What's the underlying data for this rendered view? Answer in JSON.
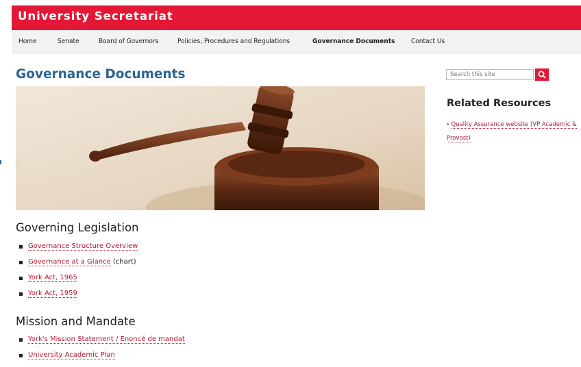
{
  "header": {
    "site_title": "University Secretariat"
  },
  "nav": {
    "items": [
      {
        "label": "Home"
      },
      {
        "label": "Senate"
      },
      {
        "label": "Board of Governors"
      },
      {
        "label": "Policies, Procedures and Regulations"
      },
      {
        "label": "Governance Documents"
      },
      {
        "label": "Contact Us"
      }
    ],
    "active": "Governance Documents"
  },
  "main": {
    "page_title": "Governance Documents",
    "hero_image": "gavel-on-sound-block",
    "sections": [
      {
        "heading": "Governing Legislation",
        "items": [
          {
            "link": "Governance Structure Overview",
            "note": ""
          },
          {
            "link": "Governance at a Glance",
            "note": " (chart)"
          },
          {
            "link": "York Act, 1965",
            "note": ""
          },
          {
            "link": "York Act, 1959",
            "note": ""
          }
        ]
      },
      {
        "heading": "Mission and Mandate",
        "items": [
          {
            "link": "York's Mission Statement / Enoncé de mandat",
            "note": ""
          },
          {
            "link": "University Academic Plan",
            "note": ""
          }
        ]
      }
    ]
  },
  "sidebar": {
    "search_placeholder": "Search this site",
    "related_heading": "Related Resources",
    "related_links": [
      "Quality Assurance website (VP Academic & Provost)"
    ]
  },
  "colors": {
    "brand_red": "#e31837",
    "link_red": "#b3182f",
    "title_blue": "#2a6496",
    "nav_bg": "#f2f2f2"
  },
  "icons": {
    "search": "search-icon",
    "bullet": "square-bullet",
    "chevron": "chevron-right-icon"
  }
}
